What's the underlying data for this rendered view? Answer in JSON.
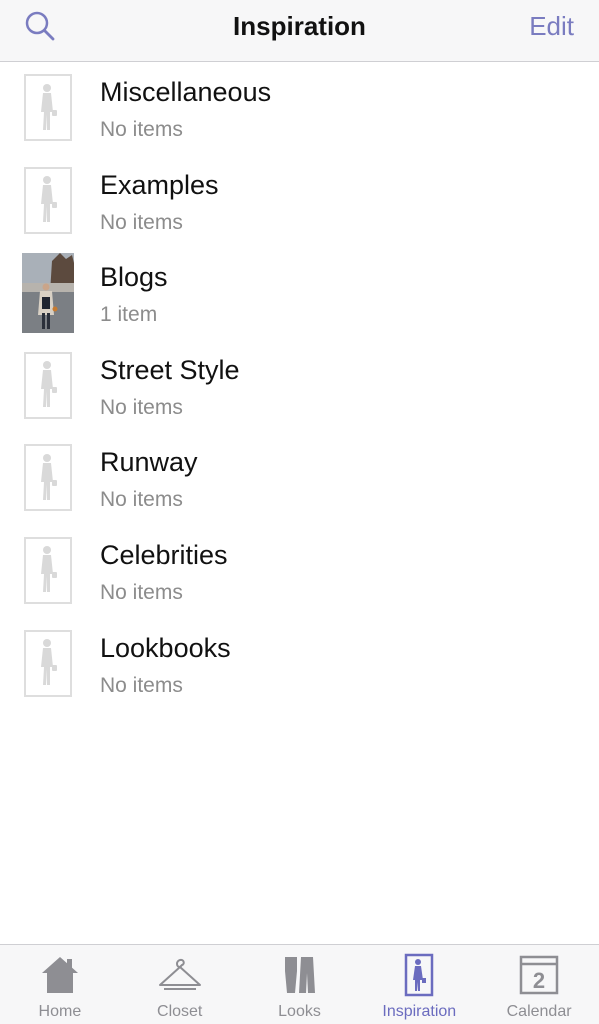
{
  "navbar": {
    "title": "Inspiration",
    "edit_label": "Edit",
    "search_icon": "search-icon"
  },
  "colors": {
    "accent": "#6b6cbf",
    "title_text": "#111111",
    "subtitle_text": "#8c8c8c",
    "placeholder_figure": "#d9d9d9"
  },
  "albums": [
    {
      "title": "Miscellaneous",
      "subtitle": "No items",
      "thumbnail": "figure-placeholder-icon"
    },
    {
      "title": "Examples",
      "subtitle": "No items",
      "thumbnail": "figure-placeholder-icon"
    },
    {
      "title": "Blogs",
      "subtitle": "1 item",
      "thumbnail": "photo"
    },
    {
      "title": "Street Style",
      "subtitle": "No items",
      "thumbnail": "figure-placeholder-icon"
    },
    {
      "title": "Runway",
      "subtitle": "No items",
      "thumbnail": "figure-placeholder-icon"
    },
    {
      "title": "Celebrities",
      "subtitle": "No items",
      "thumbnail": "figure-placeholder-icon"
    },
    {
      "title": "Lookbooks",
      "subtitle": "No items",
      "thumbnail": "figure-placeholder-icon"
    }
  ],
  "tabbar": {
    "tabs": [
      {
        "label": "Home",
        "icon": "home-icon",
        "active": false
      },
      {
        "label": "Closet",
        "icon": "hanger-icon",
        "active": false
      },
      {
        "label": "Looks",
        "icon": "looks-icon",
        "active": false
      },
      {
        "label": "Inspiration",
        "icon": "inspiration-icon",
        "active": true
      },
      {
        "label": "Calendar",
        "icon": "calendar-icon",
        "active": false,
        "badge": "2"
      }
    ]
  }
}
